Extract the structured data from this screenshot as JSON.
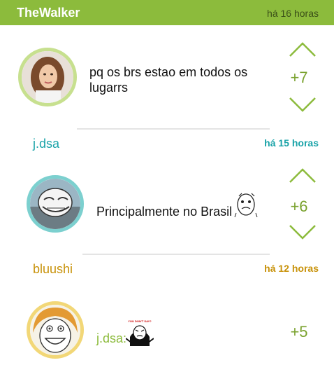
{
  "header": {
    "username": "TheWalker",
    "time": "há 16 horas"
  },
  "posts": [
    {
      "author": "",
      "time": "",
      "text": "pq os brs estao em todos os lugarrs",
      "score": "+7"
    },
    {
      "author": "j.dsa",
      "time": "há 15 horas",
      "text": "Principalmente no Brasil",
      "score": "+6"
    },
    {
      "author": "bluushi",
      "time": "há 12 horas",
      "text": "j.dsa:",
      "score": "+5",
      "meme_caption": "YOU DON'T SAY?"
    }
  ],
  "colors": {
    "accent": "#8cbb3c",
    "teal": "#1aa3a8",
    "gold": "#c8920a",
    "upvote": "#7aa22e"
  }
}
